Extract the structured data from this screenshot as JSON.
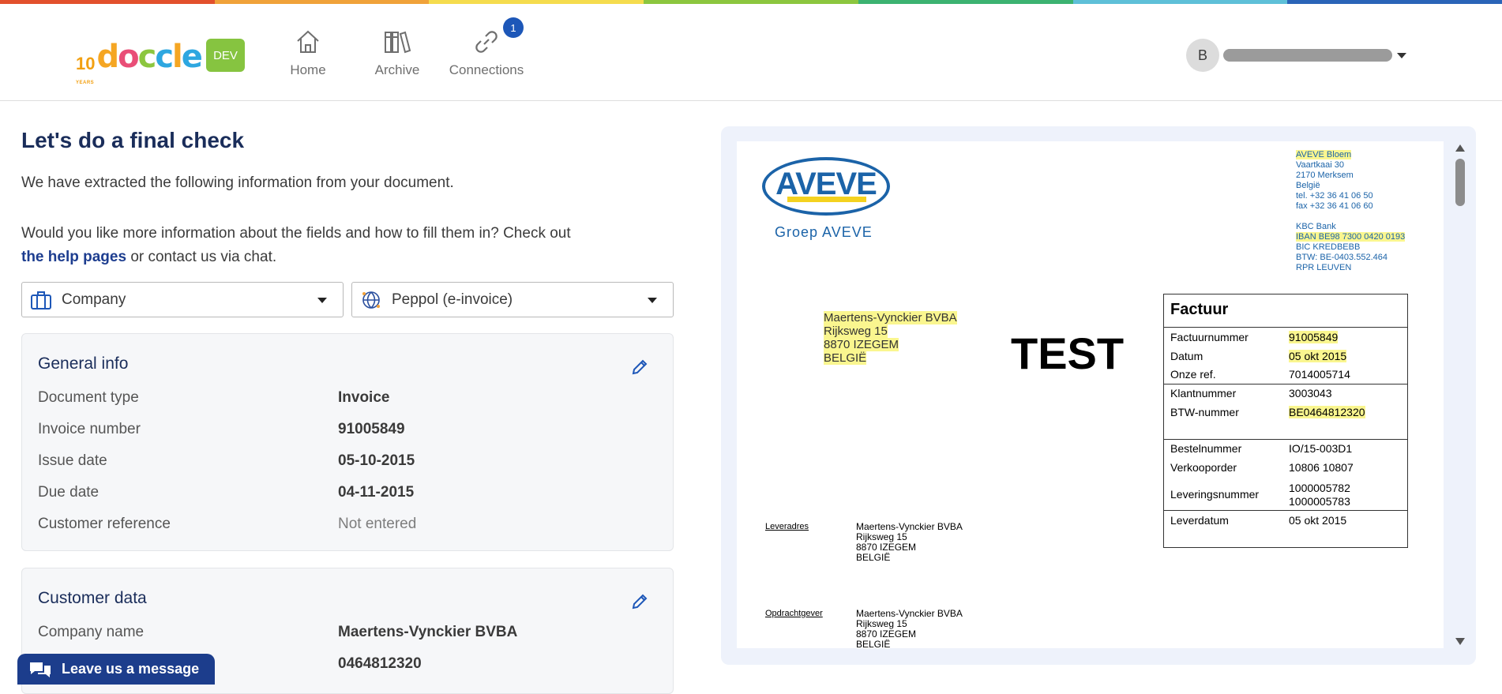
{
  "colors": {
    "rainbow": [
      "#e2502d",
      "#f0a23a",
      "#f5dc4e",
      "#8cc63f",
      "#3cb371",
      "#5ec0d8",
      "#2a64b8"
    ],
    "brand_navy": "#1a2d5a",
    "dev_green": "#86c440"
  },
  "header": {
    "dev_badge": "DEV",
    "nav": [
      {
        "label": "Home",
        "icon": "home-icon"
      },
      {
        "label": "Archive",
        "icon": "archive-icon"
      },
      {
        "label": "Connections",
        "icon": "link-icon",
        "badge": "1"
      }
    ],
    "user_initial": "B"
  },
  "main": {
    "title": "Let's do a final check",
    "intro": "We have extracted the following information from your document.",
    "help_prefix": "Would you like more information about the fields and how to fill them in? Check out",
    "help_link": "the help pages",
    "help_suffix": "or contact us via chat.",
    "select_recipient": "Company",
    "select_channel": "Peppol (e-invoice)",
    "general": {
      "title": "General info",
      "rows": [
        {
          "label": "Document type",
          "value": "Invoice"
        },
        {
          "label": "Invoice number",
          "value": "91005849"
        },
        {
          "label": "Issue date",
          "value": "05-10-2015"
        },
        {
          "label": "Due date",
          "value": "04-11-2015"
        },
        {
          "label": "Customer reference",
          "value": "Not entered"
        }
      ]
    },
    "customer": {
      "title": "Customer data",
      "rows": [
        {
          "label": "Company name",
          "value": "Maertens-Vynckier BVBA"
        },
        {
          "label": "",
          "value": "0464812320"
        }
      ]
    },
    "chat_label": "Leave us a message"
  },
  "document": {
    "logo_text": "AVEVE",
    "group_text": "Groep AVEVE",
    "sender_lines": [
      "AVEVE Bloem",
      "Vaartkaai 30",
      "2170 Merksem",
      "België",
      "tel. +32 36 41 06 50",
      "fax +32 36 41 06 60",
      "",
      "KBC Bank",
      "IBAN BE98 7300 0420 0193",
      "BIC KREDBEBB",
      "BTW: BE-0403.552.464",
      "RPR LEUVEN"
    ],
    "client_lines": [
      "Maertens-Vynckier BVBA",
      "Rijksweg 15",
      "8870 IZEGEM",
      "BELGIË"
    ],
    "watermark": "TEST",
    "invoice_box": {
      "title": "Factuur",
      "rows": [
        {
          "k": "Factuurnummer",
          "v": "91005849"
        },
        {
          "k": "Datum",
          "v": "05 okt 2015"
        },
        {
          "k": "Onze ref.",
          "v": "7014005714"
        },
        {
          "k": "Klantnummer",
          "v": "3003043"
        },
        {
          "k": "BTW-nummer",
          "v": "BE0464812320"
        },
        {
          "k": "Bestelnummer",
          "v": "IO/15-003D1"
        },
        {
          "k": "Verkooporder",
          "v": "10806 10807"
        },
        {
          "k": "Leveringsnummer",
          "v": "1000005782"
        },
        {
          "k": "",
          "v": "1000005783"
        },
        {
          "k": "Leverdatum",
          "v": "05 okt 2015"
        }
      ]
    },
    "delivery_label": "Leveradres",
    "delivery_lines": [
      "Maertens-Vynckier BVBA",
      "Rijksweg 15",
      "8870 IZEGEM",
      "BELGIË"
    ],
    "orderer_label": "Opdrachtgever",
    "orderer_lines": [
      "Maertens-Vynckier BVBA",
      "Rijksweg 15",
      "8870 IZEGEM",
      "BELGIË"
    ]
  }
}
